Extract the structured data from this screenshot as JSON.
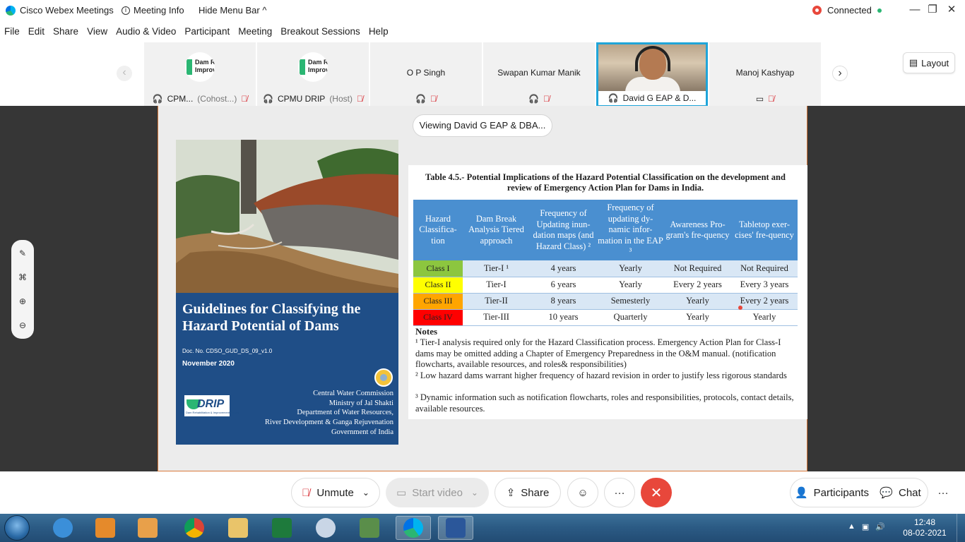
{
  "titlebar": {
    "app_title": "Cisco Webex Meetings",
    "meeting_info": "Meeting Info",
    "hide_menu": "Hide Menu Bar",
    "hide_menu_chevron": "^",
    "connection_status": "Connected",
    "minimize": "—",
    "maximize": "❐",
    "close": "✕"
  },
  "menu": [
    "File",
    "Edit",
    "Share",
    "View",
    "Audio & Video",
    "Participant",
    "Meeting",
    "Breakout Sessions",
    "Help"
  ],
  "strip": {
    "prev": "‹",
    "next": "›",
    "layout_label": "Layout",
    "tiles": [
      {
        "name": "CPM...",
        "role": "(Cohost...)",
        "avatar_text": "Dam R\nImprov"
      },
      {
        "name": "CPMU DRIP",
        "role": "(Host)",
        "avatar_text": "Dam R\nImprov"
      },
      {
        "name": "O P Singh",
        "role": ""
      },
      {
        "name": "Swapan Kumar Manik",
        "role": ""
      },
      {
        "name": "David G EAP & D...",
        "role": ""
      },
      {
        "name": "Manoj Kashyap",
        "role": ""
      }
    ]
  },
  "viewing": "Viewing David G EAP & DBA...",
  "cover": {
    "title": "Guidelines for Classifying the Hazard Potential of Dams",
    "doc_no": "Doc. No. CDSO_GUD_DS_09_v1.0",
    "date": "November 2020",
    "org_lines": [
      "Central Water Commission",
      "Ministry of Jal Shakti",
      "Department of Water Resources,",
      "River Development & Ganga Rejuvenation",
      "Government of India"
    ],
    "logo_text": "DRIP",
    "logo_sub": "Dam Rehabilitation & Improvement Project"
  },
  "table": {
    "caption": "Table 4.5.- Potential Implications of the Hazard Potential Classification on the development and review of Emergency Action Plan for Dams in India.",
    "headers": [
      "Hazard Classifica-tion",
      "Dam Break Analysis Tiered approach",
      "Frequency of Updating inun-dation maps (and Hazard Class) ²",
      "Frequency of updating dy-namic infor-mation in the EAP ³",
      "Awareness Pro-gram's fre-quency",
      "Tabletop exer-cises' fre-quency"
    ],
    "rows": [
      {
        "cls": "Class I",
        "color": "#8cc63f",
        "tier": "Tier-I ¹",
        "maps": "4 years",
        "dyn": "Yearly",
        "aware": "Not Required",
        "table": "Not Required"
      },
      {
        "cls": "Class II",
        "color": "#ffff00",
        "tier": "Tier-I",
        "maps": "6 years",
        "dyn": "Yearly",
        "aware": "Every 2 years",
        "table": "Every 3 years"
      },
      {
        "cls": "Class III",
        "color": "#ffa500",
        "tier": "Tier-II",
        "maps": "8 years",
        "dyn": "Semesterly",
        "aware": "Yearly",
        "table": "Every 2 years"
      },
      {
        "cls": "Class IV",
        "color": "#ff0000",
        "tier": "Tier-III",
        "maps": "10 years",
        "dyn": "Quarterly",
        "aware": "Yearly",
        "table": "Yearly"
      }
    ],
    "notes_heading": "Notes",
    "notes": [
      "¹ Tier-I analysis required only for the Hazard Classification process. Emergency Action Plan for Class-I dams may be omitted adding a Chapter of Emergency Preparedness in the O&M manual. (notification flowcharts, available resources, and roles& responsibilities)",
      "² Low hazard dams warrant higher frequency of hazard revision in order to justify less rigorous standards",
      "³ Dynamic information such as notification flowcharts, roles and responsibilities, protocols, contact details, available resources."
    ]
  },
  "controls": {
    "unmute": "Unmute",
    "start_video": "Start video",
    "share": "Share",
    "participants": "Participants",
    "chat": "Chat",
    "more": "···",
    "chevron": "⌄",
    "end": "✕"
  },
  "taskbar": {
    "time": "12:48",
    "date": "08-02-2021"
  }
}
